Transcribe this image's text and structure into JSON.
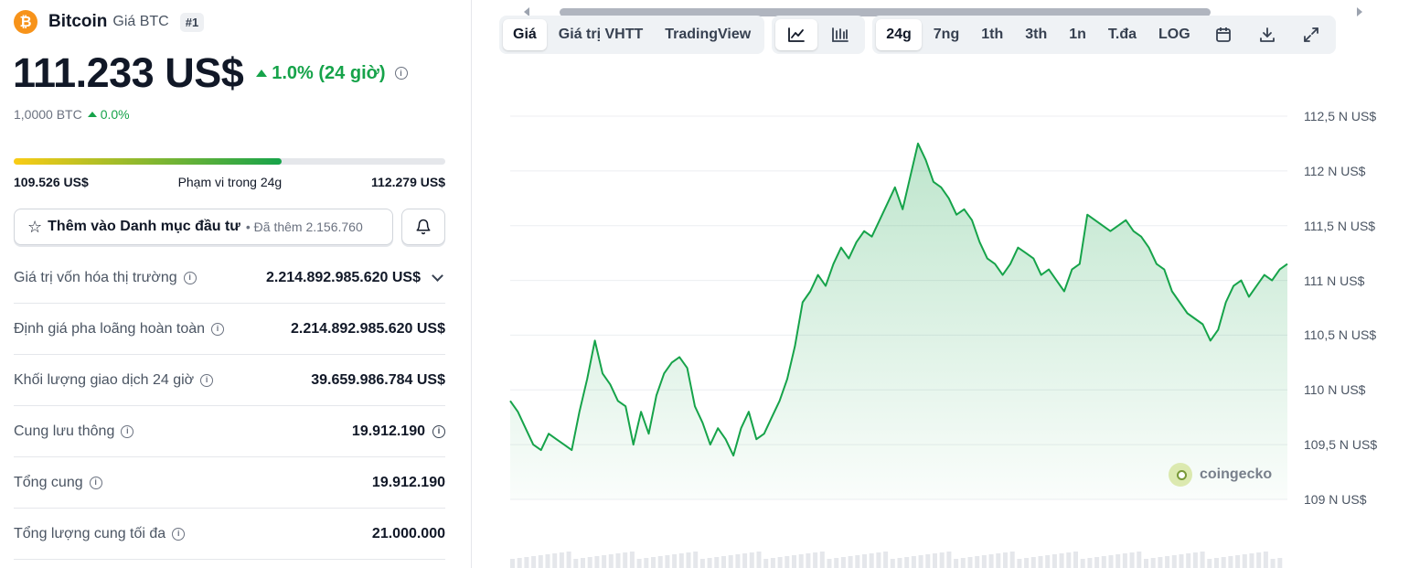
{
  "coin": {
    "logo_glyph": "₿",
    "name": "Bitcoin",
    "subtitle": "Giá BTC",
    "rank": "#1",
    "price": "111.233 US$",
    "change": "1.0% (24 giờ)",
    "btc_value": "1,0000 BTC",
    "btc_change": "0.0%"
  },
  "range": {
    "low": "109.526 US$",
    "label": "Phạm vi trong 24g",
    "high": "112.279 US$",
    "fill_fraction": 0.62
  },
  "watchlist": {
    "label": "Thêm vào Danh mục đầu tư",
    "added": "• Đã thêm 2.156.760"
  },
  "stats": [
    {
      "label": "Giá trị vốn hóa thị trường",
      "value": "2.214.892.985.620 US$"
    },
    {
      "label": "Định giá pha loãng hoàn toàn",
      "value": "2.214.892.985.620 US$"
    },
    {
      "label": "Khối lượng giao dịch 24 giờ",
      "value": "39.659.986.784 US$"
    },
    {
      "label": "Cung lưu thông",
      "value": "19.912.190"
    },
    {
      "label": "Tổng cung",
      "value": "19.912.190"
    },
    {
      "label": "Tổng lượng cung tối đa",
      "value": "21.000.000"
    }
  ],
  "toolbar": {
    "tabs": [
      "Giá",
      "Giá trị VHTT",
      "TradingView"
    ],
    "active_tab": "Giá",
    "ranges": [
      "24g",
      "7ng",
      "1th",
      "3th",
      "1n",
      "T.đa",
      "LOG"
    ],
    "active_range": "24g",
    "icons": [
      "line-chart-icon",
      "candlestick-icon",
      "calendar-icon",
      "download-icon",
      "expand-icon"
    ]
  },
  "watermark": "coingecko",
  "colors": {
    "line": "#16a34a",
    "up": "#16a34a",
    "brand_btc": "#f7931a"
  },
  "chart_data": {
    "type": "area",
    "y_ticks": [
      "112,5 N US$",
      "112 N US$",
      "111,5 N US$",
      "111 N US$",
      "110,5 N US$",
      "110 N US$",
      "109,5 N US$",
      "109 N US$"
    ],
    "ylim": [
      109000,
      112500
    ],
    "y_tick_values": [
      112500,
      112000,
      111500,
      111000,
      110500,
      110000,
      109500,
      109000
    ],
    "series": [
      {
        "values": [
          109900,
          109800,
          109650,
          109500,
          109450,
          109600,
          109550,
          109500,
          109450,
          109800,
          110100,
          110450,
          110150,
          110050,
          109900,
          109850,
          109500,
          109800,
          109600,
          109950,
          110150,
          110250,
          110300,
          110200,
          109850,
          109700,
          109500,
          109650,
          109550,
          109400,
          109650,
          109800,
          109550,
          109600,
          109750,
          109900,
          110100,
          110400,
          110800,
          110900,
          111050,
          110950,
          111150,
          111300,
          111200,
          111350,
          111450,
          111400,
          111550,
          111700,
          111850,
          111650,
          111950,
          112250,
          112100,
          111900,
          111850,
          111750,
          111600,
          111650,
          111550,
          111350,
          111200,
          111150,
          111050,
          111150,
          111300,
          111250,
          111200,
          111050,
          111100,
          111000,
          110900,
          111100,
          111150,
          111600,
          111550,
          111500,
          111450,
          111500,
          111550,
          111450,
          111400,
          111300,
          111150,
          111100,
          110900,
          110800,
          110700,
          110650,
          110600,
          110450,
          110550,
          110800,
          110950,
          111000,
          110850,
          110950,
          111050,
          111000,
          111100,
          111150
        ]
      }
    ],
    "x_range": "24h",
    "grid": true
  }
}
